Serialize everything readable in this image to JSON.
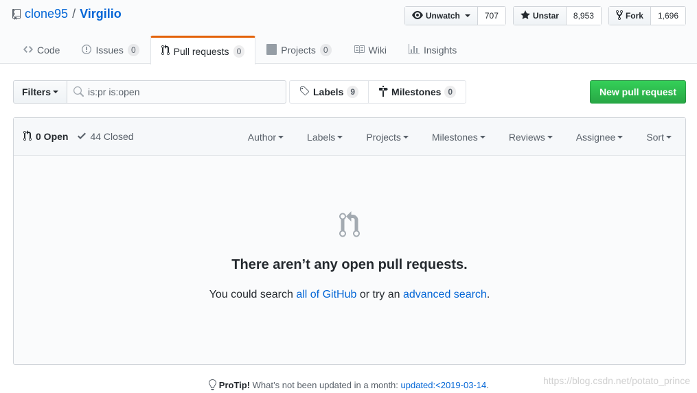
{
  "repo": {
    "owner": "clone95",
    "separator": "/",
    "name": "Virgilio"
  },
  "actions": {
    "watch": {
      "label": "Unwatch",
      "count": "707"
    },
    "star": {
      "label": "Unstar",
      "count": "8,953"
    },
    "fork": {
      "label": "Fork",
      "count": "1,696"
    }
  },
  "nav": {
    "code": "Code",
    "issues": {
      "label": "Issues",
      "count": "0"
    },
    "pulls": {
      "label": "Pull requests",
      "count": "0"
    },
    "projects": {
      "label": "Projects",
      "count": "0"
    },
    "wiki": "Wiki",
    "insights": "Insights"
  },
  "subnav": {
    "filters_label": "Filters",
    "search_value": "is:pr is:open",
    "labels": {
      "label": "Labels",
      "count": "9"
    },
    "milestones": {
      "label": "Milestones",
      "count": "0"
    },
    "new_pr": "New pull request"
  },
  "list": {
    "open": "0 Open",
    "closed": "44 Closed",
    "sorts": [
      "Author",
      "Labels",
      "Projects",
      "Milestones",
      "Reviews",
      "Assignee",
      "Sort"
    ]
  },
  "blankslate": {
    "title": "There aren’t any open pull requests.",
    "text_prefix": "You could search ",
    "link1": "all of GitHub",
    "text_middle": " or try an ",
    "link2": "advanced search",
    "text_suffix": "."
  },
  "protip": {
    "label": "ProTip!",
    "text": " What’s not been updated in a month: ",
    "link": "updated:<2019-03-14",
    "suffix": "."
  },
  "watermark": "https://blog.csdn.net/potato_prince",
  "colors": {
    "accent": "#0366d6",
    "selected_tab": "#e36209",
    "primary_button": "#28a745"
  }
}
